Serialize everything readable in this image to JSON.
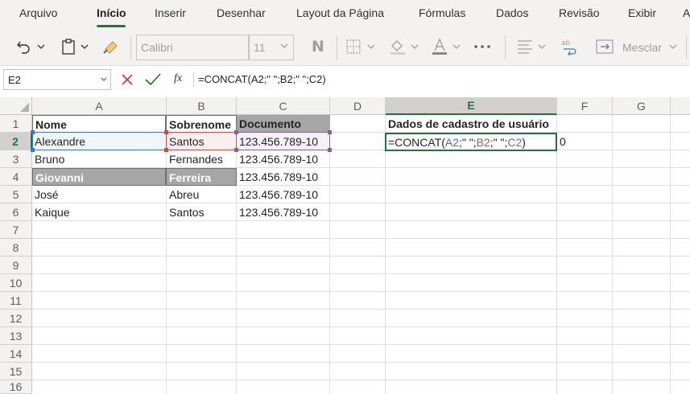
{
  "ribbon": {
    "tabs": [
      {
        "label": "Arquivo",
        "active": false
      },
      {
        "label": "Início",
        "active": true
      },
      {
        "label": "Inserir",
        "active": false
      },
      {
        "label": "Desenhar",
        "active": false
      },
      {
        "label": "Layout da Página",
        "active": false
      },
      {
        "label": "Fórmulas",
        "active": false
      },
      {
        "label": "Dados",
        "active": false
      },
      {
        "label": "Revisão",
        "active": false
      },
      {
        "label": "Exibir",
        "active": false
      },
      {
        "label": "A",
        "active": false
      }
    ]
  },
  "toolbar": {
    "font_name": "Calibri",
    "font_size": "11",
    "bold_label": "N",
    "merge_label": "Mesclar",
    "icons": [
      "undo-icon",
      "paste-icon",
      "format-painter-icon",
      "borders-icon",
      "fill-color-icon",
      "font-color-icon",
      "more-icon",
      "align-icon",
      "wrap-text-icon",
      "merge-icon"
    ]
  },
  "formula_bar": {
    "name_box": "E2",
    "fx_label": "fx",
    "formula": "=CONCAT(A2;\" \";B2;\" \";C2)"
  },
  "columns": [
    "A",
    "B",
    "C",
    "D",
    "E",
    "F",
    "G"
  ],
  "rows": [
    "1",
    "2",
    "3",
    "4",
    "5",
    "6",
    "7",
    "8",
    "9",
    "10",
    "11",
    "12",
    "13",
    "14",
    "15",
    "16"
  ],
  "selected_column": "E",
  "selected_row": "2",
  "sheet": {
    "headers": {
      "a": "Nome",
      "b": "Sobrenome",
      "c": "Documento"
    },
    "data_rows": [
      {
        "a": "Alexandre",
        "b": "Santos",
        "c": "123.456.789-10"
      },
      {
        "a": "Bruno",
        "b": "Fernandes",
        "c": "123.456.789-10"
      },
      {
        "a": "Giovanni",
        "b": "Ferreira",
        "c": "123.456.789-10"
      },
      {
        "a": "José",
        "b": "Abreu",
        "c": "123.456.789-10"
      },
      {
        "a": "Kaique",
        "b": "Santos",
        "c": "123.456.789-10"
      }
    ],
    "e1": "Dados de cadastro de usuário",
    "e2_formula_parts": [
      "=CONCAT(",
      "A2",
      ";\" \";",
      "B2",
      ";\" \";",
      "C2",
      ")"
    ],
    "f2": "0"
  },
  "colors": {
    "accent": "#217346",
    "ref_a": "#4472c4",
    "ref_b": "#c0504d",
    "ref_c": "#8064a2",
    "header_gray": "#a6a6a6"
  }
}
